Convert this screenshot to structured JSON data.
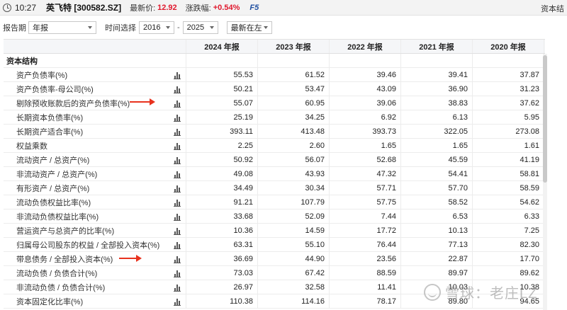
{
  "header": {
    "time": "10:27",
    "stock": "英飞特 [300582.SZ]",
    "price_label": "最新价:",
    "price": "12.92",
    "change_label": "涨跌幅:",
    "change": "+0.54%",
    "refresh": "F5",
    "right_label": "资本结",
    "accent_color": "#e0182d"
  },
  "filters": {
    "period_label": "报告期",
    "period_value": "年报",
    "time_label": "时间选择",
    "from_year": "2016",
    "range_sep": "-",
    "to_year": "2025",
    "order_value": "最新在左"
  },
  "table": {
    "columns": [
      "2024 年报",
      "2023 年报",
      "2022 年报",
      "2021 年报",
      "2020 年报"
    ],
    "section": "资本结构",
    "rows": [
      {
        "label": "资产负债率(%)",
        "values": [
          "55.53",
          "61.52",
          "39.46",
          "39.41",
          "37.87"
        ]
      },
      {
        "label": "资产负债率-母公司(%)",
        "values": [
          "50.21",
          "53.47",
          "43.09",
          "36.90",
          "31.23"
        ]
      },
      {
        "label": "剔除预收账款后的资产负债率(%)",
        "values": [
          "55.07",
          "60.95",
          "39.06",
          "38.83",
          "37.62"
        ]
      },
      {
        "label": "长期资本负债率(%)",
        "values": [
          "25.19",
          "34.25",
          "6.92",
          "6.13",
          "5.95"
        ]
      },
      {
        "label": "长期资产适合率(%)",
        "values": [
          "393.11",
          "413.48",
          "393.73",
          "322.05",
          "273.08"
        ]
      },
      {
        "label": "权益乘数",
        "values": [
          "2.25",
          "2.60",
          "1.65",
          "1.65",
          "1.61"
        ]
      },
      {
        "label": "流动资产 / 总资产(%)",
        "values": [
          "50.92",
          "56.07",
          "52.68",
          "45.59",
          "41.19"
        ]
      },
      {
        "label": "非流动资产 / 总资产(%)",
        "values": [
          "49.08",
          "43.93",
          "47.32",
          "54.41",
          "58.81"
        ]
      },
      {
        "label": "有形资产 / 总资产(%)",
        "values": [
          "34.49",
          "30.34",
          "57.71",
          "57.70",
          "58.59"
        ]
      },
      {
        "label": "流动负债权益比率(%)",
        "values": [
          "91.21",
          "107.79",
          "57.75",
          "58.52",
          "54.62"
        ]
      },
      {
        "label": "非流动负债权益比率(%)",
        "values": [
          "33.68",
          "52.09",
          "7.44",
          "6.53",
          "6.33"
        ]
      },
      {
        "label": "营运资产与总资产的比率(%)",
        "values": [
          "10.36",
          "14.59",
          "17.72",
          "10.13",
          "7.25"
        ]
      },
      {
        "label": "归属母公司股东的权益 / 全部投入资本(%)",
        "values": [
          "63.31",
          "55.10",
          "76.44",
          "77.13",
          "82.30"
        ]
      },
      {
        "label": "带息债务 / 全部投入资本(%)",
        "values": [
          "36.69",
          "44.90",
          "23.56",
          "22.87",
          "17.70"
        ]
      },
      {
        "label": "流动负债 / 负债合计(%)",
        "values": [
          "73.03",
          "67.42",
          "88.59",
          "89.97",
          "89.62"
        ]
      },
      {
        "label": "非流动负债 / 负债合计(%)",
        "values": [
          "26.97",
          "32.58",
          "11.41",
          "10.03",
          "10.38"
        ]
      },
      {
        "label": "资本固定化比率(%)",
        "values": [
          "110.38",
          "114.16",
          "78.17",
          "89.80",
          "94.65"
        ]
      }
    ]
  },
  "watermark": "雪球：老庄LZ"
}
